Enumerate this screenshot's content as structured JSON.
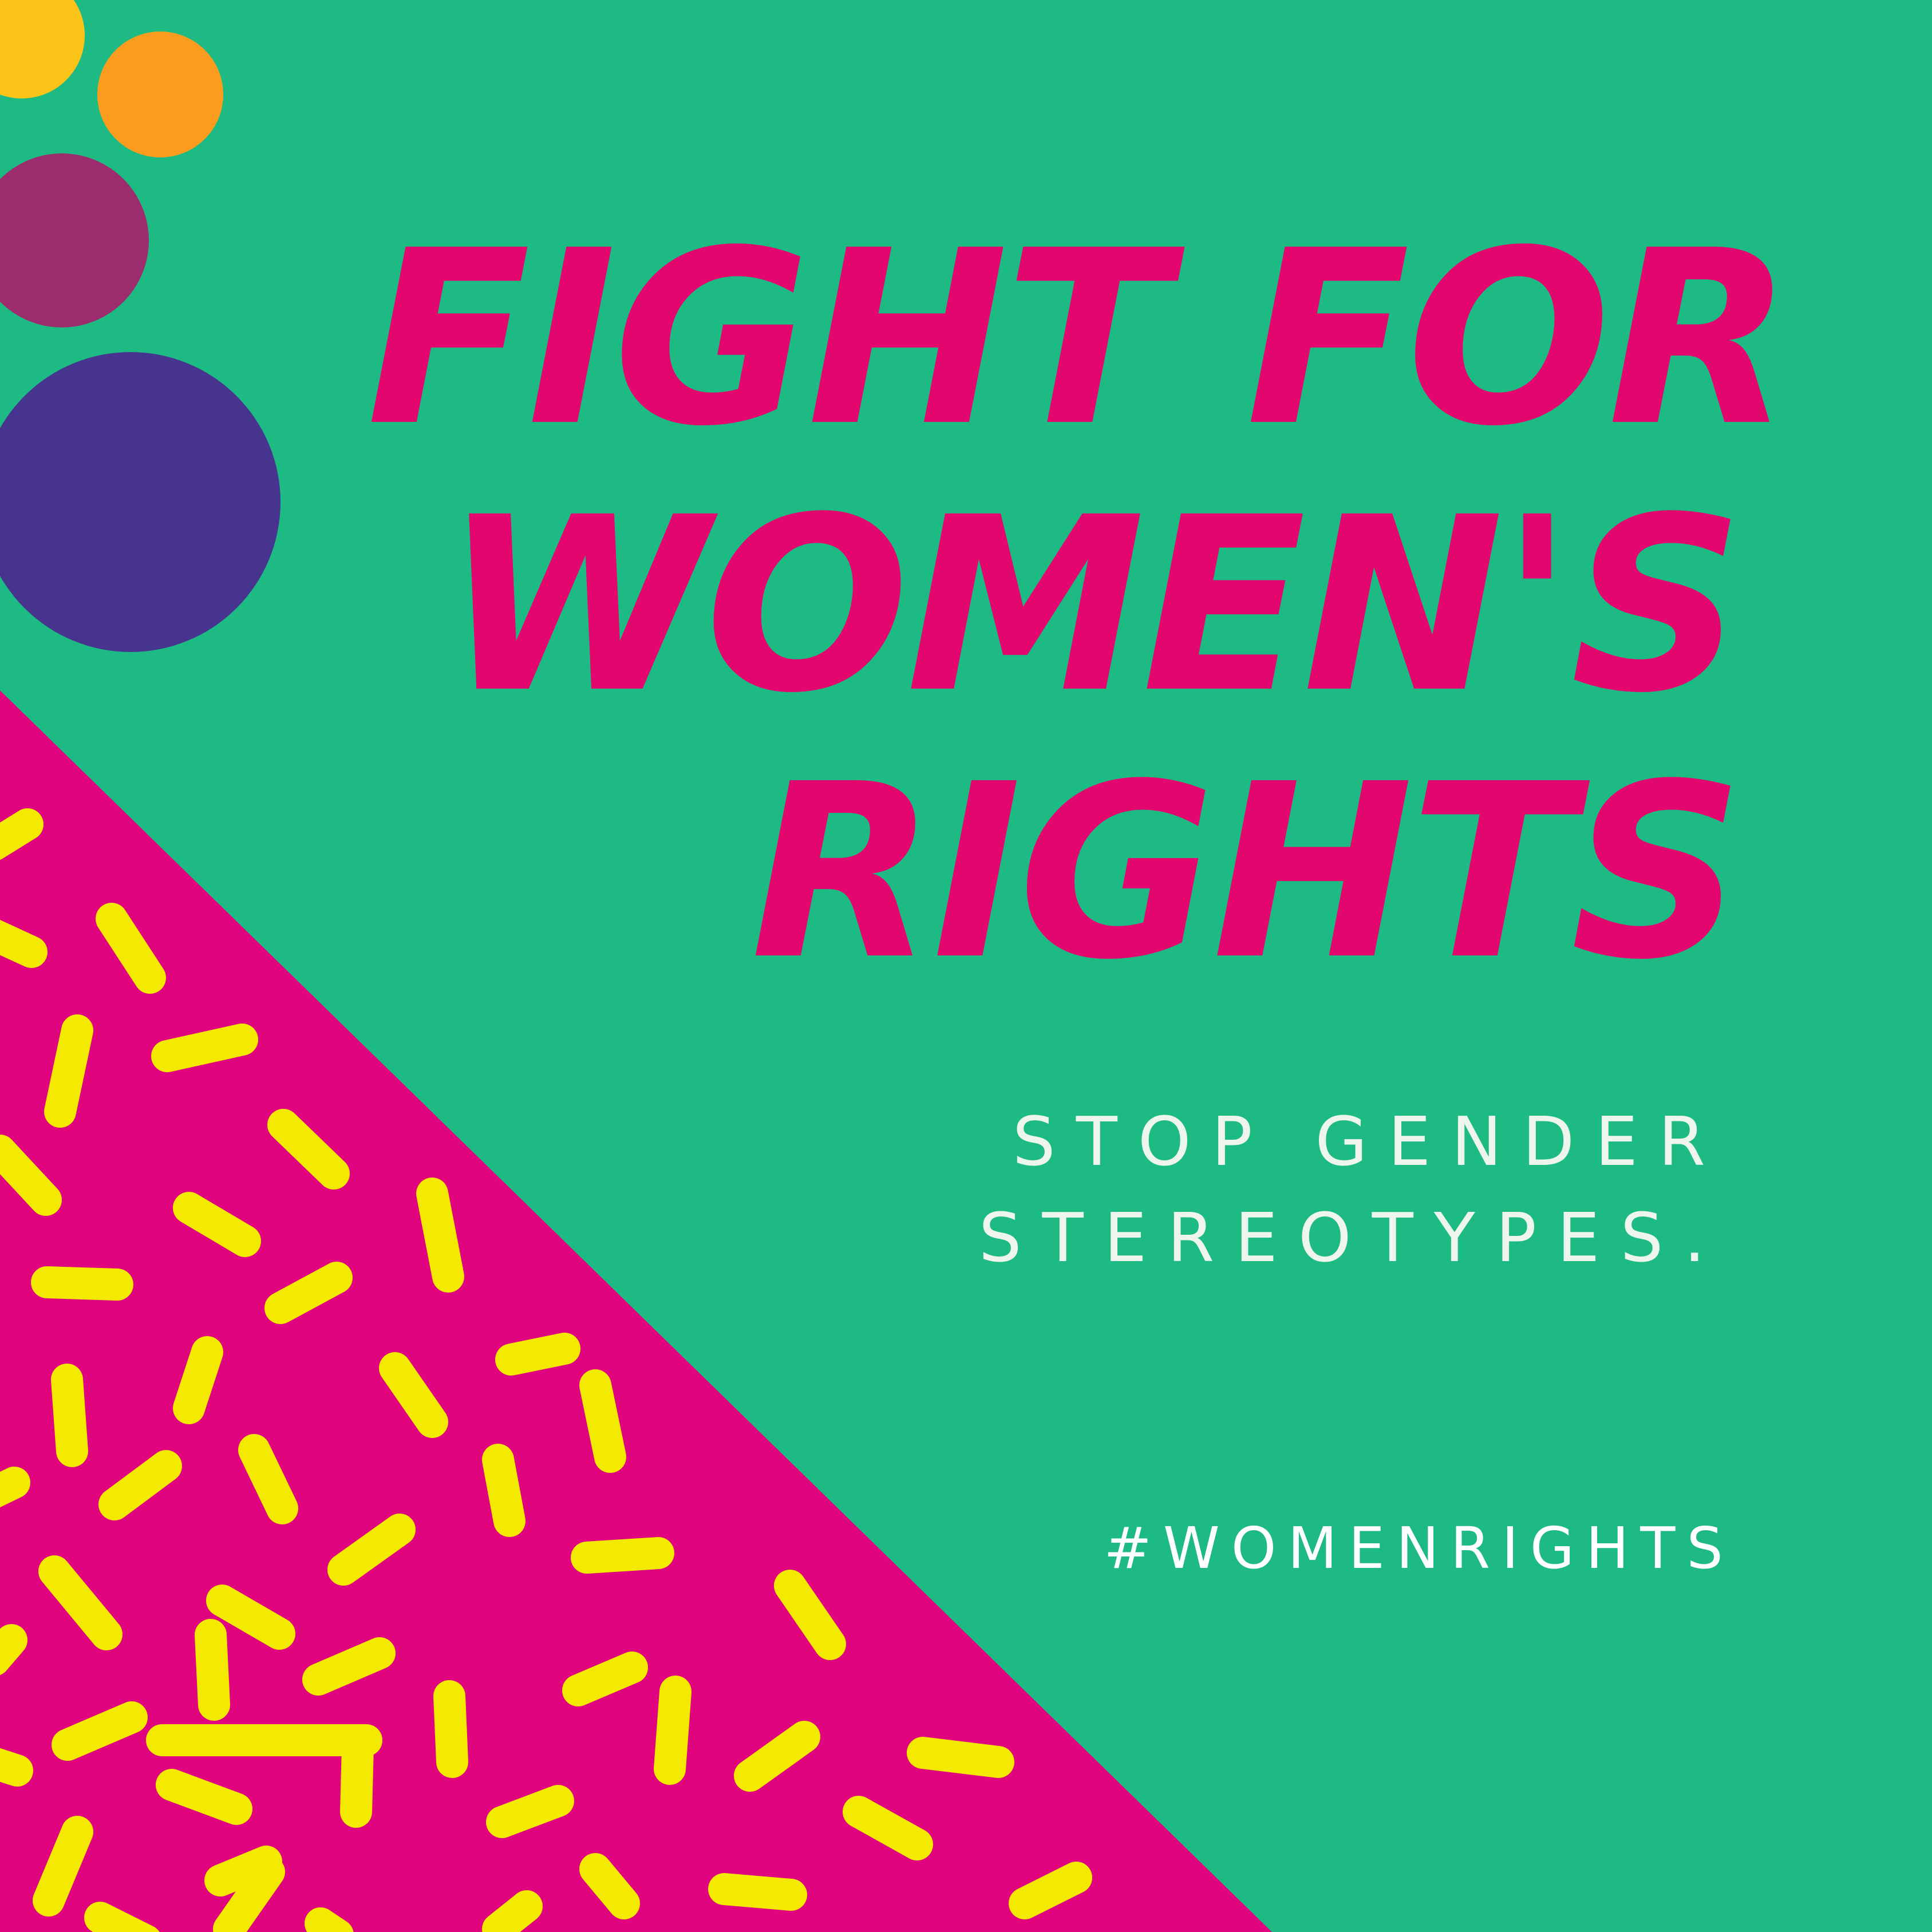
{
  "colors": {
    "background": "#1dbb83",
    "triangle": "#e0047f",
    "sprinkles": "#f4ea00",
    "headline": "#e3066e",
    "subtitle": "#eef5ef",
    "hashtag": "#ffffff",
    "dot_yellow": "#fcc419",
    "dot_orange": "#fb9c1f",
    "dot_plum": "#9c2c6e",
    "dot_indigo": "#47348f"
  },
  "headline": {
    "lines": [
      "FIGHT FOR",
      "WOMEN'S",
      "RIGHTS"
    ]
  },
  "subtitle": {
    "lines": [
      "STOP GENDER",
      "STEREOTYPES."
    ]
  },
  "hashtag": {
    "text": "#WOMENRIGHTS"
  }
}
